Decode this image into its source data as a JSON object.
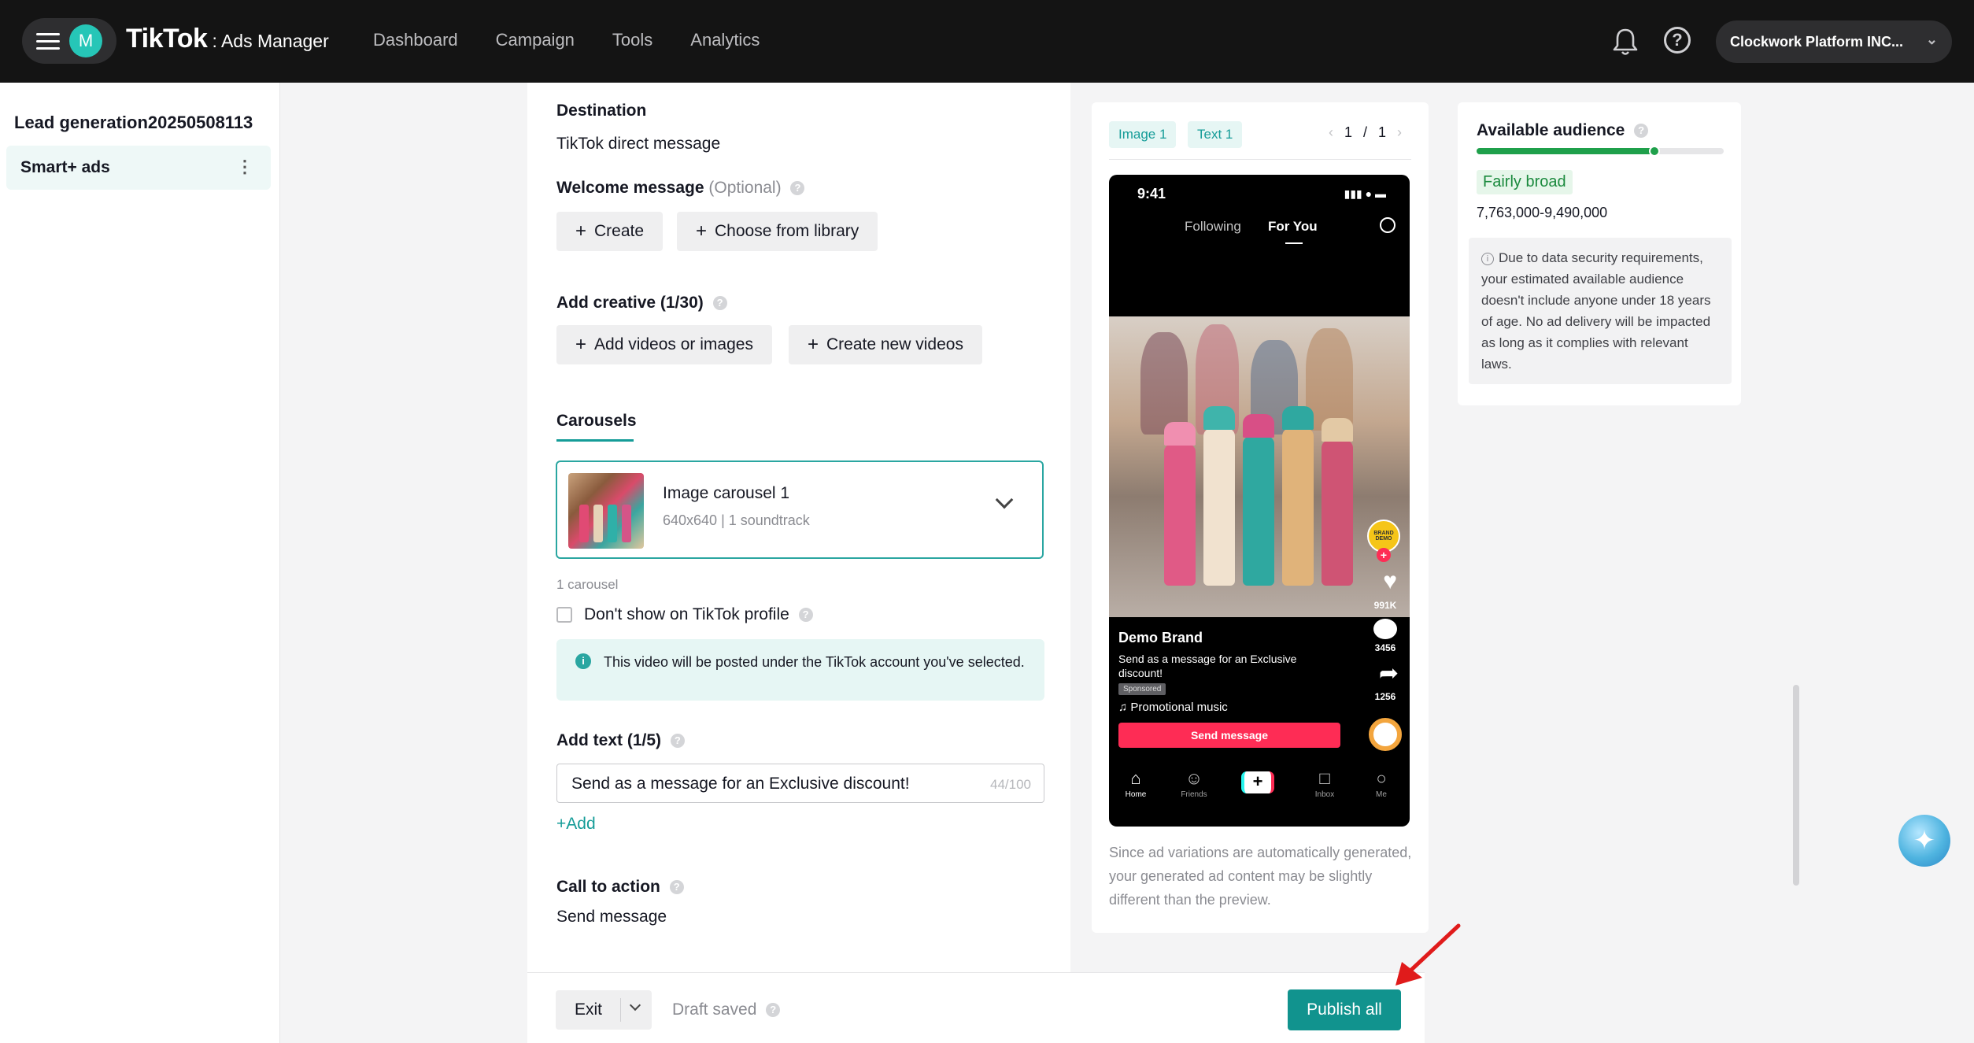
{
  "topbar": {
    "avatar_letter": "M",
    "logo_main": "TikTok",
    "logo_sub": ": Ads Manager",
    "nav": [
      "Dashboard",
      "Campaign",
      "Tools",
      "Analytics"
    ],
    "account": "Clockwork Platform INC..."
  },
  "sidebar": {
    "campaign_name": "Lead generation20250508113",
    "item": "Smart+ ads"
  },
  "form": {
    "destination_label": "Destination",
    "destination_value": "TikTok direct message",
    "welcome_label": "Welcome message",
    "welcome_optional": "(Optional)",
    "create_button": "Create",
    "library_button": "Choose from library",
    "creative_label": "Add creative (1/30)",
    "add_media_button": "Add videos or images",
    "create_videos_button": "Create new videos",
    "carousels_tab": "Carousels",
    "carousel_title": "Image carousel 1",
    "carousel_meta": "640x640 | 1 soundtrack",
    "carousel_count": "1 carousel",
    "hide_profile_label": "Don't show on TikTok profile",
    "info_text": "This video will be posted under the TikTok account you've selected.",
    "add_text_label": "Add text (1/5)",
    "text_value": "Send as a message for an Exclusive discount!",
    "text_counter": "44/100",
    "add_link": "+Add",
    "cta_label": "Call to action",
    "cta_value": "Send message"
  },
  "bottombar": {
    "exit": "Exit",
    "draft": "Draft saved",
    "publish": "Publish all"
  },
  "preview": {
    "tabs": [
      "Image 1",
      "Text 1"
    ],
    "page_current": "1",
    "page_sep": "/",
    "page_total": "1",
    "phone": {
      "time": "9:41",
      "tab_following": "Following",
      "tab_foryou": "For You",
      "brand_badge": "BRAND DEMO",
      "likes": "991K",
      "comments": "3456",
      "shares": "1256",
      "brand": "Demo Brand",
      "caption": "Send as a message for an Exclusive discount!",
      "sponsored": "Sponsored",
      "music": "♫ Promotional music",
      "cta": "Send message",
      "nav": [
        "Home",
        "Friends",
        "",
        "Inbox",
        "Me"
      ]
    },
    "note": "Since ad variations are automatically generated, your generated ad content may be slightly different than the preview."
  },
  "audience": {
    "title": "Available audience",
    "level": "Fairly broad",
    "level_fraction": 0.72,
    "range": "7,763,000-9,490,000",
    "note": "Due to data security requirements, your estimated available audience doesn't include anyone under 18 years of age. No ad delivery will be impacted as long as it complies with relevant laws."
  },
  "colors": {
    "accent": "#11938e",
    "topbar": "#141414",
    "tiktok_red": "#fe2c55",
    "audience_green": "#1fa04b"
  },
  "icons": [
    "hamburger-icon",
    "bell-icon",
    "help-icon",
    "chevron-down-icon",
    "kebab-icon",
    "question-icon",
    "info-icon",
    "plus-icon",
    "sparkle-icon"
  ]
}
